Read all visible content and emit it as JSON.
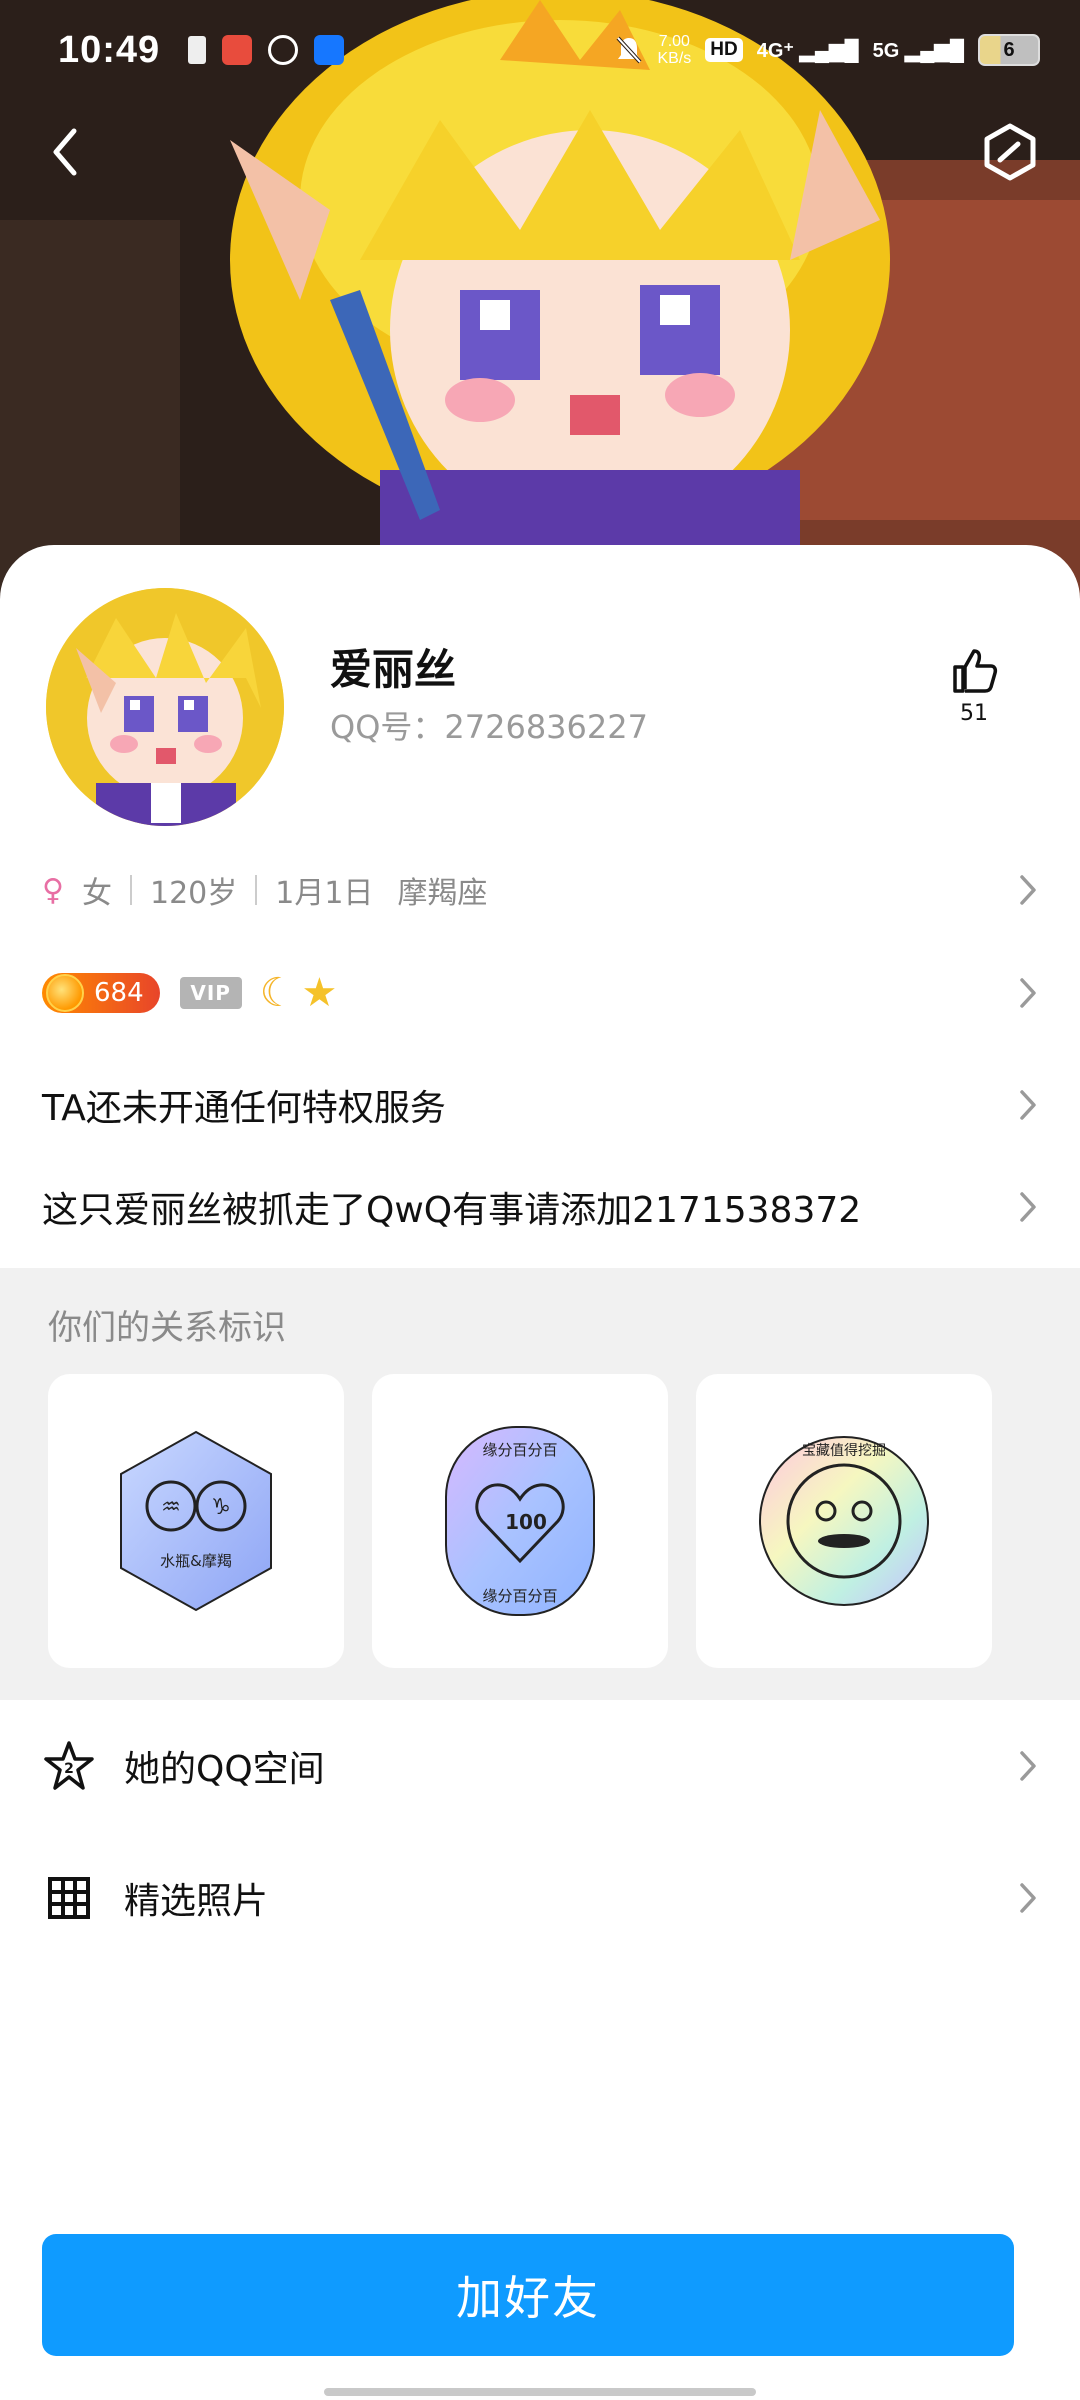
{
  "status_bar": {
    "time": "10:49",
    "net_speed_value": "7.00",
    "net_speed_unit": "KB/s",
    "hd_label": "HD",
    "sim1": "4G⁺",
    "sim2": "5G",
    "battery": "6"
  },
  "header": {
    "back_icon": "chevron-left-icon",
    "edit_icon": "hexagon-edit-icon"
  },
  "profile": {
    "name": "爱丽丝",
    "qq_number": "QQ号：2726836227",
    "like_count": "51"
  },
  "info": {
    "gender": "女",
    "age": "120岁",
    "birthday": "1月1日",
    "zodiac": "摩羯座"
  },
  "badges": {
    "coin_level": "684",
    "vip": "VIP",
    "moon_icon": "moon-icon",
    "star_icon": "star-icon"
  },
  "privileges": "TA还未开通任何特权服务",
  "signature": "这只爱丽丝被抓走了QwQ有事请添加2171538372",
  "relationship": {
    "title": "你们的关系标识",
    "cards": [
      {
        "label": "水瓶&摩羯"
      },
      {
        "label_top": "缘分百分百",
        "label_bottom": "缘分百分百",
        "number": "100"
      },
      {
        "label": "宝藏值得挖掘"
      }
    ]
  },
  "menu": {
    "zone": "她的QQ空间",
    "photos": "精选照片"
  },
  "add_friend": "加好友",
  "colors": {
    "primary": "#0f9bff",
    "section_bg": "#f1f1f1",
    "secondary_text": "#8a8a8a"
  }
}
